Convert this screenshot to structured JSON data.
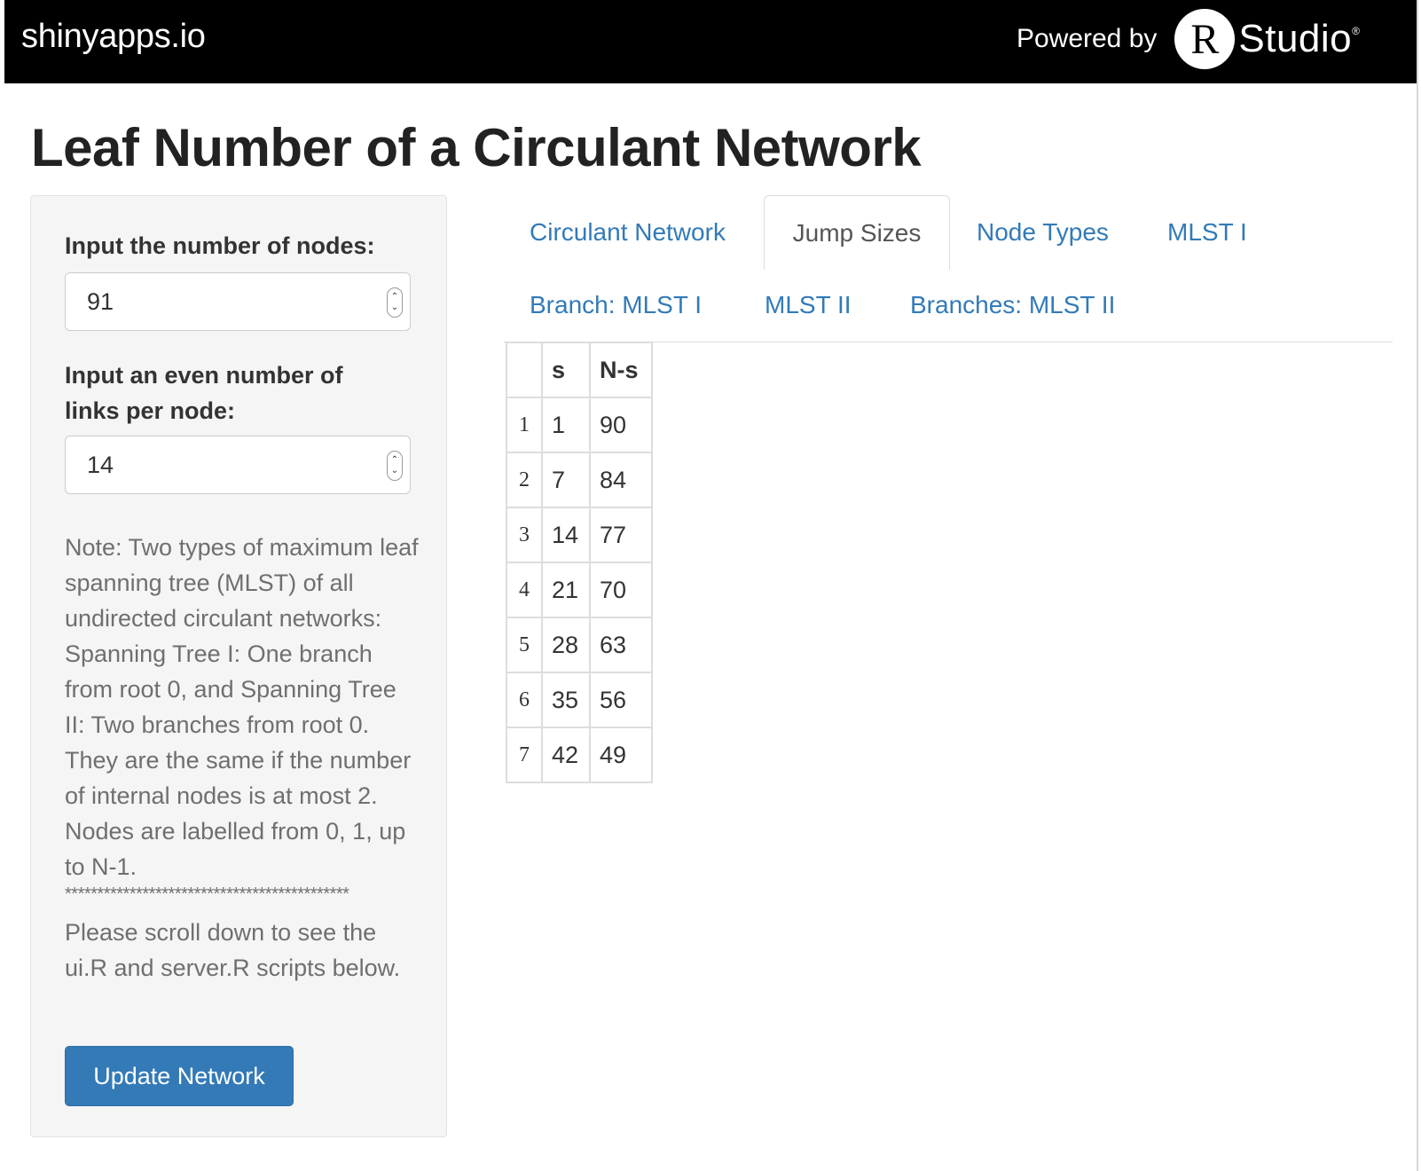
{
  "header": {
    "brand": "shinyapps.io",
    "powered_by": "Powered by",
    "logo_letter": "R",
    "logo_word": "Studio",
    "logo_reg": "®"
  },
  "page": {
    "title": "Leaf Number of a Circulant Network"
  },
  "sidebar": {
    "nodes_label": "Input the number of nodes:",
    "nodes_value": "91",
    "links_label_line1": "Input an even number of",
    "links_label_line2": "links per node:",
    "links_value": "14",
    "note": "Note: Two types of maximum leaf spanning tree (MLST) of all undirected circulant networks: Spanning Tree I: One branch from root 0, and Spanning Tree II: Two branches from root 0. They are the same if the number of internal nodes is at most 2. Nodes are labelled from 0, 1, up to N-1.",
    "stars": "********************************************",
    "note2": "Please scroll down to see the ui.R and server.R scripts below.",
    "update_button": "Update Network"
  },
  "tabs": {
    "items": [
      {
        "label": "Circulant Network",
        "active": false
      },
      {
        "label": "Jump Sizes",
        "active": true
      },
      {
        "label": "Node Types",
        "active": false
      },
      {
        "label": "MLST I",
        "active": false
      },
      {
        "label": "Branch: MLST I",
        "active": false
      },
      {
        "label": "MLST II",
        "active": false
      },
      {
        "label": "Branches: MLST II",
        "active": false
      }
    ]
  },
  "table": {
    "headers": [
      "",
      "s",
      "N-s"
    ],
    "rows": [
      [
        "1",
        "1",
        "90"
      ],
      [
        "2",
        "7",
        "84"
      ],
      [
        "3",
        "14",
        "77"
      ],
      [
        "4",
        "21",
        "70"
      ],
      [
        "5",
        "28",
        "63"
      ],
      [
        "6",
        "35",
        "56"
      ],
      [
        "7",
        "42",
        "49"
      ]
    ]
  },
  "colors": {
    "link": "#337ab7",
    "button": "#337ab7",
    "topbar": "#000000",
    "sidebar_bg": "#f5f5f5"
  }
}
